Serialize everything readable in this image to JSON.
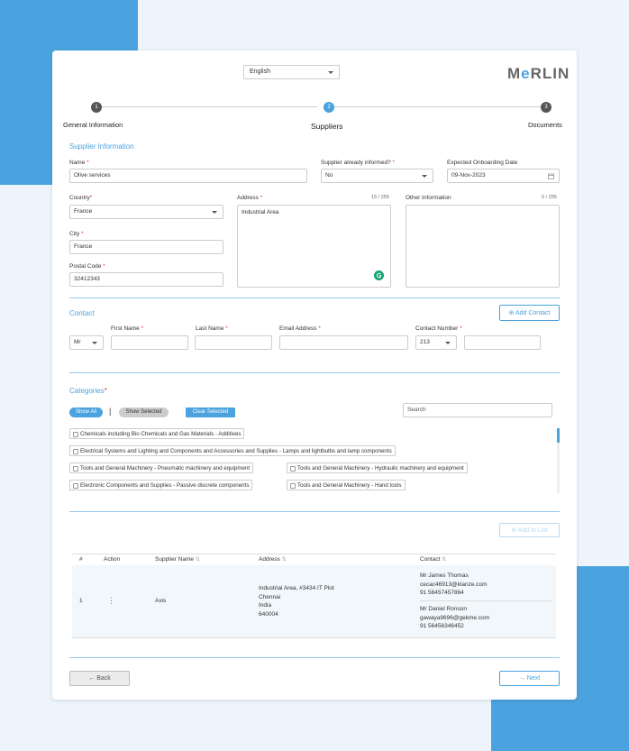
{
  "header": {
    "language": "English",
    "logo_pre": "M",
    "logo_e": "e",
    "logo_post": "RLIN"
  },
  "steps": [
    {
      "num": "1",
      "label": "General Information"
    },
    {
      "num": "2",
      "label": "Suppliers"
    },
    {
      "num": "3",
      "label": "Documents"
    }
  ],
  "supplier": {
    "section_title": "Supplier Information",
    "name_label": "Name",
    "name_value": "Olive services",
    "informed_label": "Supplier already informed?",
    "informed_value": "No",
    "onboard_label": "Expected Onboarding Date",
    "onboard_value": "09-Nov-2023",
    "country_label": "Country",
    "country_value": "France",
    "address_label": "Address",
    "address_counter": "15 / 255",
    "address_value": "Industrial Area",
    "other_label": "Other Information",
    "other_counter": "0 / 255",
    "city_label": "City",
    "city_value": "France",
    "postal_label": "Postal Code",
    "postal_value": "32412343",
    "required_mark": "*"
  },
  "contact": {
    "section_title": "Contact",
    "add_button": "Add Contact",
    "title_value": "Mr",
    "first_label": "First Name",
    "last_label": "Last Name",
    "email_label": "Email Address",
    "number_label": "Contact Number",
    "code_value": "213"
  },
  "categories": {
    "section_title": "Categories",
    "show_all": "Show All",
    "divider": "|",
    "show_selected": "Show Selected",
    "clear_selected": "Clear Selected",
    "search_placeholder": "Search",
    "items": [
      "Chemicals including Bio Chemicals and Gas Materials - Additives",
      "Electrical Systems and Lighting and Components and Accessories and Supplies - Lamps and lightbulbs and lamp components",
      "Tools and General Machinery - Pneumatic machinery and equipment",
      "Tools and General Machinery - Hydraulic machinery and equipment",
      "Electronic Components and Supplies - Passive discrete components",
      "Tools and General Machinery - Hand tools"
    ]
  },
  "list": {
    "add_button": "Add to List",
    "headers": {
      "num": "#",
      "action": "Action",
      "supplier": "Supplier Name",
      "address": "Address",
      "contact": "Contact"
    },
    "row": {
      "num": "1",
      "action": "⋮",
      "supplier": "Axis",
      "addr1": "Industrial Area, #3434 IT Plot",
      "addr2": "Chennai",
      "addr3": "India",
      "addr4": "640004",
      "c1_name": "Mr James Thomas",
      "c1_email": "cecac46913@klanze.com",
      "c1_phone": "91 56457457864",
      "c2_name": "Mr Daniel Ronson",
      "c2_email": "gawaya9696@gekme.com",
      "c2_phone": "91 56456346452"
    }
  },
  "footer": {
    "back": "Back",
    "next": "Next"
  },
  "colors": {
    "accent": "#4aa3de",
    "required": "#e53935"
  }
}
